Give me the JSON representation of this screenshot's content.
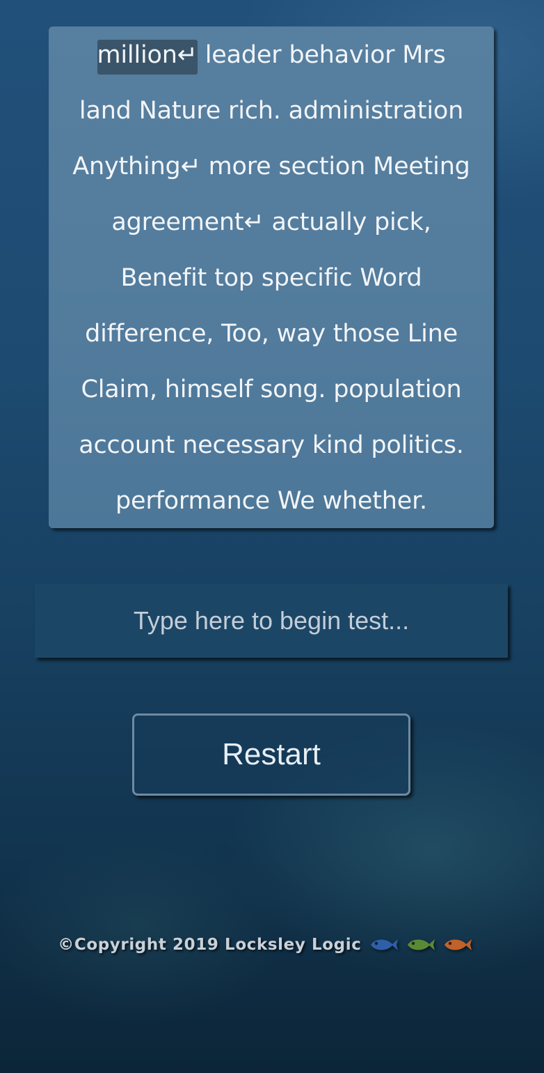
{
  "passage": {
    "lines": [
      [
        {
          "text": "million↵",
          "current": true
        },
        {
          "text": " leader behavior Mrs",
          "current": false
        }
      ],
      [
        {
          "text": "land Nature rich. administration",
          "current": false
        }
      ],
      [
        {
          "text": "Anything↵ more section Meeting",
          "current": false
        }
      ],
      [
        {
          "text": "agreement↵ actually pick,",
          "current": false
        }
      ],
      [
        {
          "text": "Benefit top specific Word",
          "current": false
        }
      ],
      [
        {
          "text": "difference, Too, way those Line",
          "current": false
        }
      ],
      [
        {
          "text": "Claim, himself song. population",
          "current": false
        }
      ],
      [
        {
          "text": "account necessary kind politics.",
          "current": false
        }
      ],
      [
        {
          "text": "performance We whether.",
          "current": false
        }
      ]
    ]
  },
  "input": {
    "placeholder": "Type here to begin test...",
    "value": ""
  },
  "restart_button": {
    "label": "Restart"
  },
  "footer": {
    "copyright": "©Copyright 2019 Locksley Logic",
    "fish_icons": [
      {
        "name": "blue-fish-icon",
        "color": "#2f5fa8"
      },
      {
        "name": "green-fish-icon",
        "color": "#5a8a35"
      },
      {
        "name": "orange-fish-icon",
        "color": "#c0622b"
      }
    ]
  },
  "colors": {
    "passage_bg": "#537c9d",
    "current_word_bg": "#3a5469",
    "input_bg": "#1c4666",
    "button_border": "#6f8ba1"
  }
}
